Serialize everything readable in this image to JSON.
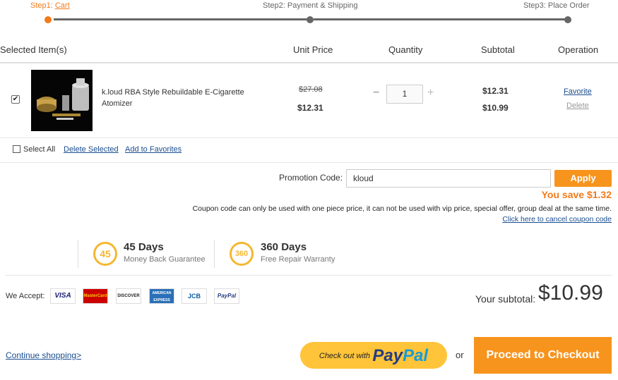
{
  "steps": {
    "step1_prefix": "Step1: ",
    "step1_link": "Cart",
    "step2": "Step2: Payment & Shipping",
    "step3": "Step3: Place Order"
  },
  "columns": {
    "items": "Selected Item(s)",
    "unit_price": "Unit Price",
    "quantity": "Quantity",
    "subtotal": "Subtotal",
    "operation": "Operation"
  },
  "item": {
    "checked": true,
    "name": "k.loud RBA Style Rebuildable E-Cigarette Atomizer",
    "original_price": "$27.08",
    "unit_price": "$12.31",
    "quantity": "1",
    "minus": "−",
    "plus": "+",
    "subtotal_original": "$12.31",
    "subtotal_discounted": "$10.99",
    "favorite": "Favorite",
    "delete": "Delete"
  },
  "selection": {
    "select_all": "Select All",
    "delete_selected": "Delete Selected",
    "add_to_favorites": "Add to Favorites"
  },
  "promo": {
    "label": "Promotion Code:",
    "value": "kloud",
    "apply": "Apply",
    "you_save": "You save $1.32",
    "note": "Coupon code can only be used with one piece price, it can not be used with vip price, special offer, group deal at the same time.",
    "cancel_link": "Click here to cancel coupon code"
  },
  "guarantees": [
    {
      "badge": "45",
      "title": "45 Days",
      "subtitle": "Money Back Guarantee"
    },
    {
      "badge": "360",
      "title": "360 Days",
      "subtitle": "Free Repair Warranty"
    }
  ],
  "payment": {
    "label": "We Accept:",
    "cards": [
      "VISA",
      "MasterCard",
      "DISCOVER",
      "AMERICAN EXPRESS",
      "JCB",
      "PayPal"
    ]
  },
  "summary": {
    "subtotal_label": "Your subtotal:",
    "subtotal_value": "$10.99"
  },
  "actions": {
    "continue": "Continue shopping>",
    "paypal_prefix": "Check out with",
    "paypal_word1": "Pay",
    "paypal_word2": "Pal",
    "or": "or",
    "checkout": "Proceed to Checkout"
  },
  "colors": {
    "accent": "#f7941d",
    "link": "#1a4d8f",
    "badge": "#f5b731",
    "paypal_yellow": "#ffc439"
  }
}
